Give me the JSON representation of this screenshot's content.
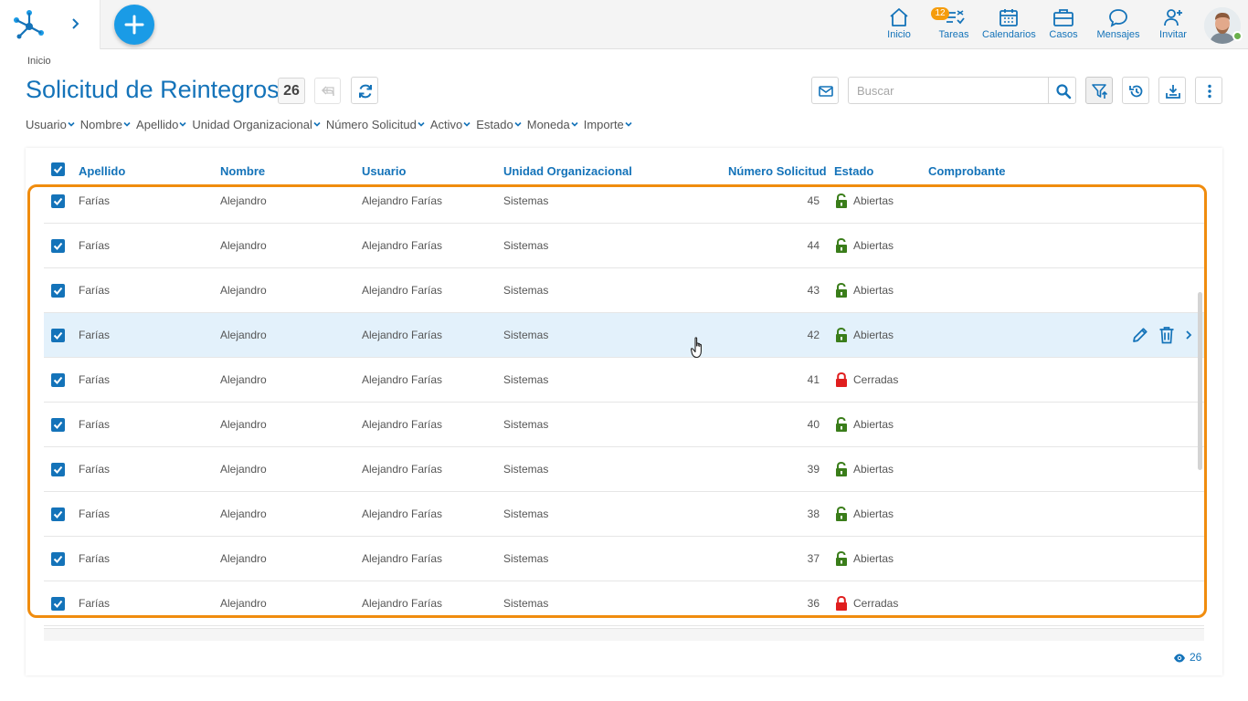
{
  "nav": {
    "items": [
      {
        "key": "home",
        "label": "Inicio",
        "icon": "home-icon"
      },
      {
        "key": "tasks",
        "label": "Tareas",
        "icon": "tasks-icon",
        "badge": "12"
      },
      {
        "key": "calendars",
        "label": "Calendarios",
        "icon": "calendar-icon"
      },
      {
        "key": "cases",
        "label": "Casos",
        "icon": "briefcase-icon"
      },
      {
        "key": "messages",
        "label": "Mensajes",
        "icon": "chat-icon"
      },
      {
        "key": "invite",
        "label": "Invitar",
        "icon": "add-user-icon"
      }
    ]
  },
  "breadcrumb": "Inicio",
  "page": {
    "title": "Solicitud de Reintegros",
    "count": "26"
  },
  "search": {
    "placeholder": "Buscar",
    "value": ""
  },
  "filters": [
    "Usuario",
    "Nombre",
    "Apellido",
    "Unidad Organizacional",
    "Número Solicitud",
    "Activo",
    "Estado",
    "Moneda",
    "Importe"
  ],
  "table": {
    "columns": {
      "apellido": "Apellido",
      "nombre": "Nombre",
      "usuario": "Usuario",
      "unidad": "Unidad Organizacional",
      "numero": "Número Solicitud",
      "estado": "Estado",
      "comprobante": "Comprobante"
    },
    "rows": [
      {
        "apellido": "Farías",
        "nombre": "Alejandro",
        "usuario": "Alejandro Farías",
        "unidad": "Sistemas",
        "numero": "45",
        "estado": "Abiertas",
        "locked": false
      },
      {
        "apellido": "Farías",
        "nombre": "Alejandro",
        "usuario": "Alejandro Farías",
        "unidad": "Sistemas",
        "numero": "44",
        "estado": "Abiertas",
        "locked": false
      },
      {
        "apellido": "Farías",
        "nombre": "Alejandro",
        "usuario": "Alejandro Farías",
        "unidad": "Sistemas",
        "numero": "43",
        "estado": "Abiertas",
        "locked": false
      },
      {
        "apellido": "Farías",
        "nombre": "Alejandro",
        "usuario": "Alejandro Farías",
        "unidad": "Sistemas",
        "numero": "42",
        "estado": "Abiertas",
        "locked": false
      },
      {
        "apellido": "Farías",
        "nombre": "Alejandro",
        "usuario": "Alejandro Farías",
        "unidad": "Sistemas",
        "numero": "41",
        "estado": "Cerradas",
        "locked": true
      },
      {
        "apellido": "Farías",
        "nombre": "Alejandro",
        "usuario": "Alejandro Farías",
        "unidad": "Sistemas",
        "numero": "40",
        "estado": "Abiertas",
        "locked": false
      },
      {
        "apellido": "Farías",
        "nombre": "Alejandro",
        "usuario": "Alejandro Farías",
        "unidad": "Sistemas",
        "numero": "39",
        "estado": "Abiertas",
        "locked": false
      },
      {
        "apellido": "Farías",
        "nombre": "Alejandro",
        "usuario": "Alejandro Farías",
        "unidad": "Sistemas",
        "numero": "38",
        "estado": "Abiertas",
        "locked": false
      },
      {
        "apellido": "Farías",
        "nombre": "Alejandro",
        "usuario": "Alejandro Farías",
        "unidad": "Sistemas",
        "numero": "37",
        "estado": "Abiertas",
        "locked": false
      },
      {
        "apellido": "Farías",
        "nombre": "Alejandro",
        "usuario": "Alejandro Farías",
        "unidad": "Sistemas",
        "numero": "36",
        "estado": "Cerradas",
        "locked": true
      }
    ],
    "hovered_row": 3
  },
  "footer": {
    "visible_count": "26"
  },
  "colors": {
    "primary": "#1473b9",
    "accent": "#1a9be6",
    "open_lock": "#3a7d1a",
    "closed_lock": "#e01e1e",
    "highlight": "#f08c0e",
    "badge": "#f59c0c"
  }
}
